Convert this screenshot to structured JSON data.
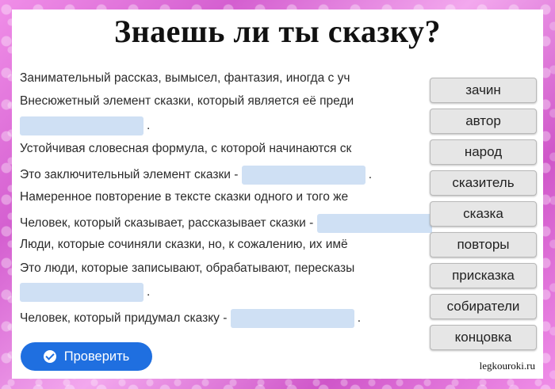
{
  "title": "Знаешь ли ты сказку?",
  "questions": [
    {
      "text": "Занимательный рассказ, вымысел, фантазия, иногда с уч"
    },
    {
      "text": "Внесюжетный элемент сказки, который является её преди"
    },
    {
      "text": "",
      "blank_placeholder": ""
    },
    {
      "text": "Устойчивая словесная формула, с которой начинаются ск"
    },
    {
      "text": "Это заключительный элемент сказки -"
    },
    {
      "text": "Намеренное повторение в тексте сказки одного и того же"
    },
    {
      "text": "Человек, который сказывает, рассказывает сказки -"
    },
    {
      "text": "Люди, которые сочиняли сказки, но, к сожалению, их имё"
    },
    {
      "text": "Это люди, которые записывают, обрабатывают, пересказы"
    },
    {
      "text": ""
    },
    {
      "text": "Человек, который придумал сказку -"
    }
  ],
  "options": [
    "зачин",
    "автор",
    "народ",
    "сказитель",
    "сказка",
    "повторы",
    "присказка",
    "собиратели",
    "концовка"
  ],
  "check_button": {
    "label": "Проверить"
  },
  "watermark": "legkouroki.ru",
  "punct": "."
}
